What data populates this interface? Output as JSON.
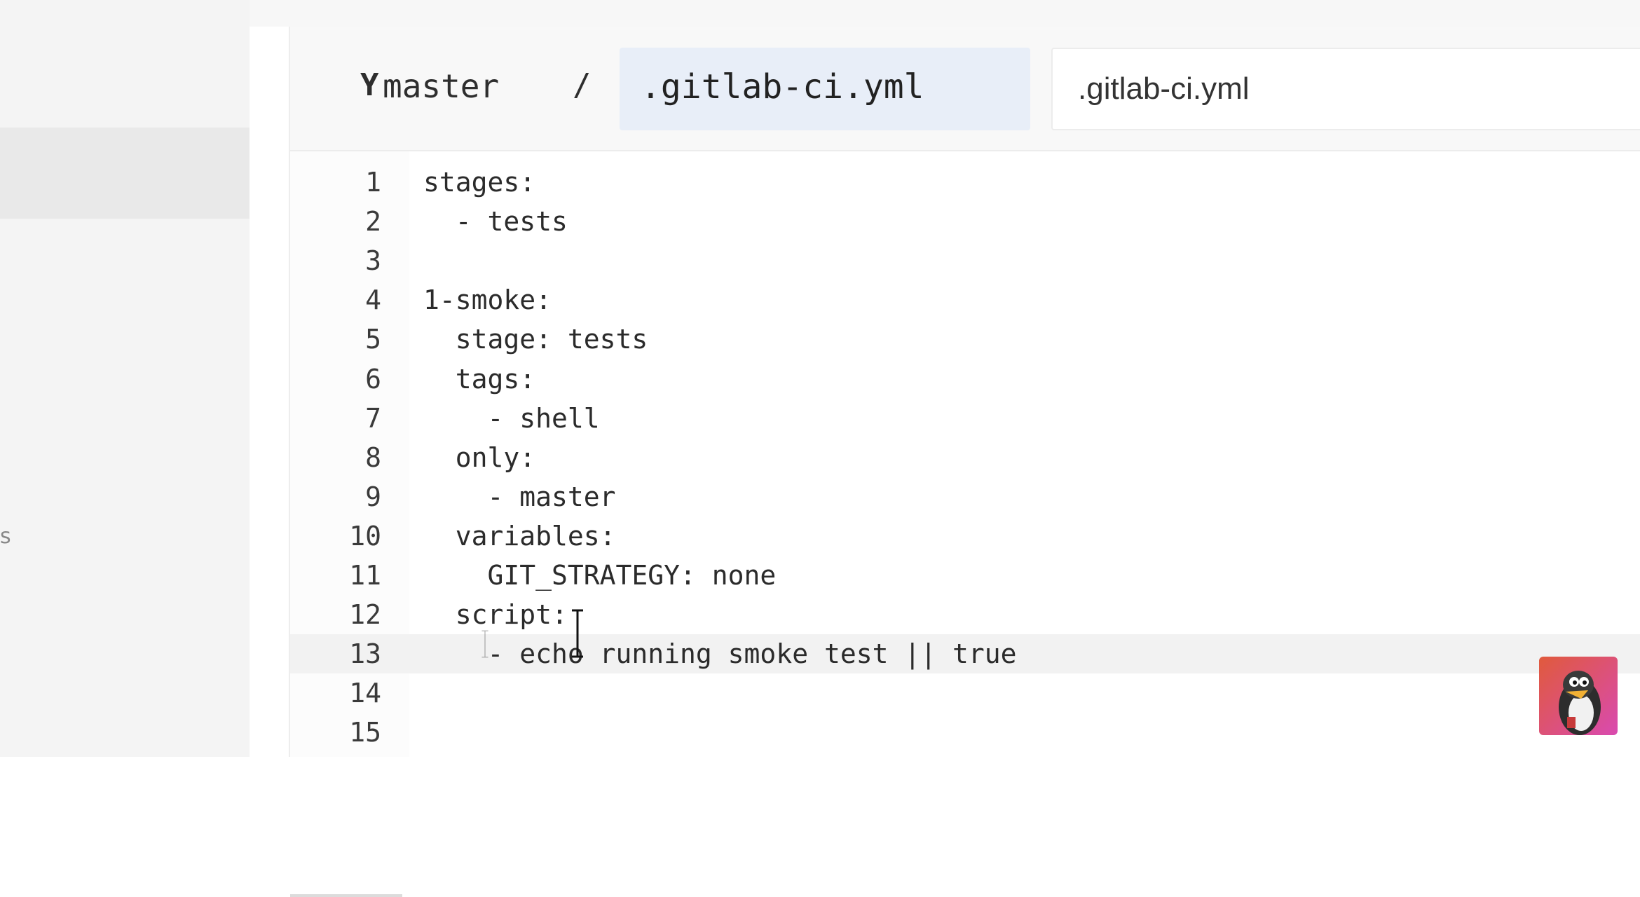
{
  "header": {
    "branch_icon": "Y",
    "branch": "master",
    "path_separator": "/",
    "file_path": ".gitlab-ci.yml",
    "file_name_value": ".gitlab-ci.yml"
  },
  "editor": {
    "current_line": 13,
    "lines": [
      {
        "number": "1",
        "text": "stages:"
      },
      {
        "number": "2",
        "text": "  - tests"
      },
      {
        "number": "3",
        "text": ""
      },
      {
        "number": "4",
        "text": "1-smoke:"
      },
      {
        "number": "5",
        "text": "  stage: tests"
      },
      {
        "number": "6",
        "text": "  tags:"
      },
      {
        "number": "7",
        "text": "    - shell"
      },
      {
        "number": "8",
        "text": "  only:"
      },
      {
        "number": "9",
        "text": "    - master"
      },
      {
        "number": "10",
        "text": "  variables:"
      },
      {
        "number": "11",
        "text": "    GIT_STRATEGY: none"
      },
      {
        "number": "12",
        "text": "  script:"
      },
      {
        "number": "13",
        "text": "    - echo running smoke test || true"
      },
      {
        "number": "14",
        "text": ""
      },
      {
        "number": "15",
        "text": ""
      }
    ]
  },
  "sidebar": {
    "fragment_text": "s"
  },
  "icons": {
    "branch": "branch-icon",
    "text_cursor": "text-cursor-icon",
    "avatar": "penguin-avatar-icon"
  },
  "colors": {
    "path_highlight": "#e8eef8",
    "current_line": "#f2f2f2",
    "sidebar_bg": "#f4f4f4"
  }
}
